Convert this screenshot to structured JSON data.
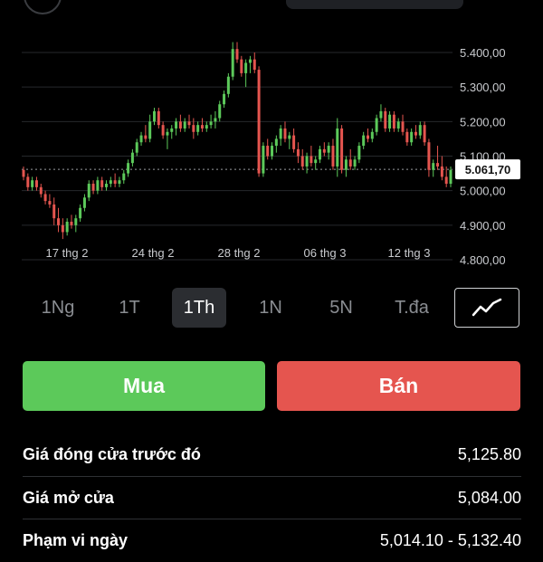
{
  "chart_data": {
    "type": "candlestick",
    "y_ticks": [
      "5.400,00",
      "5.300,00",
      "5.200,00",
      "5.100,00",
      "5.000,00",
      "4.900,00",
      "4.800,00"
    ],
    "ylim": [
      4800,
      5400
    ],
    "x_ticks": [
      "17 thg 2",
      "24 thg 2",
      "28 thg 2",
      "06 thg 3",
      "12 thg 3"
    ],
    "current_price_label": "5.061,70",
    "current_price": 5061.7,
    "up_color": "#5cc95a",
    "down_color": "#e5554f",
    "candles": [
      [
        5060,
        5070,
        5030,
        5040
      ],
      [
        5040,
        5050,
        5000,
        5010
      ],
      [
        5010,
        5040,
        5000,
        5030
      ],
      [
        5030,
        5040,
        5000,
        5010
      ],
      [
        5010,
        5020,
        4980,
        4990
      ],
      [
        4990,
        5000,
        4960,
        4970
      ],
      [
        4970,
        4990,
        4950,
        4960
      ],
      [
        4960,
        4980,
        4900,
        4920
      ],
      [
        4920,
        4950,
        4880,
        4900
      ],
      [
        4900,
        4920,
        4860,
        4880
      ],
      [
        4880,
        4920,
        4870,
        4910
      ],
      [
        4910,
        4930,
        4890,
        4900
      ],
      [
        4900,
        4930,
        4880,
        4920
      ],
      [
        4920,
        4960,
        4910,
        4950
      ],
      [
        4950,
        4990,
        4940,
        4980
      ],
      [
        4980,
        5030,
        4970,
        5020
      ],
      [
        5020,
        5030,
        4990,
        5000
      ],
      [
        5000,
        5040,
        4990,
        5030
      ],
      [
        5030,
        5040,
        5000,
        5010
      ],
      [
        5010,
        5030,
        5000,
        5020
      ],
      [
        5020,
        5040,
        5010,
        5030
      ],
      [
        5030,
        5050,
        5010,
        5020
      ],
      [
        5020,
        5040,
        5010,
        5030
      ],
      [
        5030,
        5060,
        5020,
        5050
      ],
      [
        5050,
        5090,
        5040,
        5080
      ],
      [
        5080,
        5120,
        5070,
        5110
      ],
      [
        5110,
        5150,
        5100,
        5140
      ],
      [
        5140,
        5170,
        5130,
        5160
      ],
      [
        5160,
        5190,
        5140,
        5150
      ],
      [
        5150,
        5220,
        5140,
        5200
      ],
      [
        5200,
        5240,
        5190,
        5230
      ],
      [
        5230,
        5240,
        5180,
        5190
      ],
      [
        5190,
        5200,
        5150,
        5160
      ],
      [
        5160,
        5180,
        5120,
        5170
      ],
      [
        5170,
        5190,
        5150,
        5180
      ],
      [
        5180,
        5210,
        5160,
        5200
      ],
      [
        5200,
        5220,
        5170,
        5180
      ],
      [
        5180,
        5210,
        5170,
        5200
      ],
      [
        5200,
        5220,
        5180,
        5190
      ],
      [
        5190,
        5210,
        5150,
        5170
      ],
      [
        5170,
        5200,
        5160,
        5190
      ],
      [
        5190,
        5210,
        5170,
        5180
      ],
      [
        5180,
        5200,
        5170,
        5190
      ],
      [
        5190,
        5220,
        5180,
        5200
      ],
      [
        5200,
        5230,
        5180,
        5210
      ],
      [
        5210,
        5260,
        5200,
        5250
      ],
      [
        5250,
        5290,
        5240,
        5280
      ],
      [
        5280,
        5340,
        5270,
        5330
      ],
      [
        5330,
        5430,
        5320,
        5410
      ],
      [
        5410,
        5430,
        5370,
        5380
      ],
      [
        5380,
        5390,
        5330,
        5340
      ],
      [
        5340,
        5380,
        5300,
        5370
      ],
      [
        5370,
        5390,
        5340,
        5380
      ],
      [
        5380,
        5400,
        5340,
        5350
      ],
      [
        5350,
        5360,
        5040,
        5050
      ],
      [
        5050,
        5140,
        5040,
        5130
      ],
      [
        5130,
        5150,
        5090,
        5100
      ],
      [
        5100,
        5140,
        5090,
        5130
      ],
      [
        5130,
        5160,
        5110,
        5150
      ],
      [
        5150,
        5190,
        5130,
        5180
      ],
      [
        5180,
        5200,
        5140,
        5150
      ],
      [
        5150,
        5170,
        5120,
        5160
      ],
      [
        5160,
        5180,
        5110,
        5120
      ],
      [
        5120,
        5140,
        5080,
        5100
      ],
      [
        5100,
        5120,
        5060,
        5070
      ],
      [
        5070,
        5110,
        5050,
        5100
      ],
      [
        5100,
        5130,
        5070,
        5080
      ],
      [
        5080,
        5100,
        5060,
        5090
      ],
      [
        5090,
        5130,
        5080,
        5120
      ],
      [
        5120,
        5140,
        5100,
        5110
      ],
      [
        5110,
        5140,
        5090,
        5130
      ],
      [
        5130,
        5150,
        5060,
        5070
      ],
      [
        5070,
        5210,
        5040,
        5180
      ],
      [
        5180,
        5190,
        5050,
        5060
      ],
      [
        5060,
        5100,
        5040,
        5090
      ],
      [
        5090,
        5120,
        5060,
        5070
      ],
      [
        5070,
        5100,
        5060,
        5090
      ],
      [
        5090,
        5140,
        5080,
        5130
      ],
      [
        5130,
        5170,
        5120,
        5160
      ],
      [
        5160,
        5180,
        5140,
        5150
      ],
      [
        5150,
        5180,
        5140,
        5170
      ],
      [
        5170,
        5220,
        5160,
        5210
      ],
      [
        5210,
        5250,
        5200,
        5230
      ],
      [
        5230,
        5240,
        5170,
        5180
      ],
      [
        5180,
        5230,
        5170,
        5220
      ],
      [
        5220,
        5230,
        5170,
        5180
      ],
      [
        5180,
        5210,
        5170,
        5200
      ],
      [
        5200,
        5220,
        5160,
        5170
      ],
      [
        5170,
        5180,
        5130,
        5140
      ],
      [
        5140,
        5180,
        5130,
        5170
      ],
      [
        5170,
        5190,
        5150,
        5160
      ],
      [
        5160,
        5200,
        5150,
        5190
      ],
      [
        5190,
        5200,
        5130,
        5140
      ],
      [
        5140,
        5150,
        5040,
        5060
      ],
      [
        5060,
        5090,
        5040,
        5080
      ],
      [
        5080,
        5130,
        5060,
        5070
      ],
      [
        5070,
        5100,
        5030,
        5040
      ],
      [
        5040,
        5070,
        5010,
        5020
      ],
      [
        5020,
        5070,
        5010,
        5060
      ]
    ]
  },
  "ranges": {
    "items": [
      "1Ng",
      "1T",
      "1Th",
      "1N",
      "5N",
      "T.đa"
    ],
    "active": "1Th"
  },
  "buttons": {
    "buy": "Mua",
    "sell": "Bán"
  },
  "stats": [
    {
      "label": "Giá đóng cửa trước đó",
      "value": "5,125.80"
    },
    {
      "label": "Giá mở cửa",
      "value": "5,084.00"
    },
    {
      "label": "Phạm vi ngày",
      "value": "5,014.10 - 5,132.40"
    }
  ]
}
